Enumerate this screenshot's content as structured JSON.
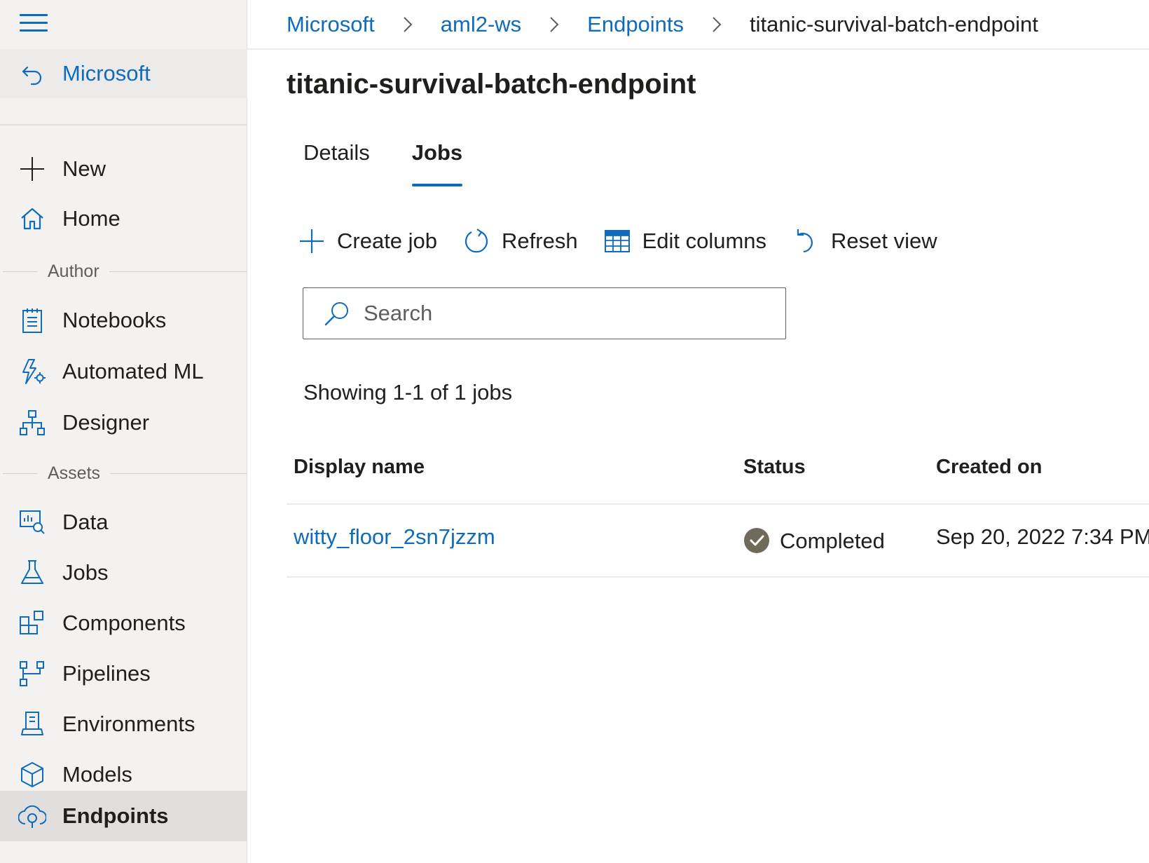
{
  "sidebar": {
    "back_label": "Microsoft",
    "items_top": [
      {
        "label": "New",
        "icon": "plus-icon"
      },
      {
        "label": "Home",
        "icon": "home-icon"
      }
    ],
    "section_author": "Author",
    "items_author": [
      {
        "label": "Notebooks",
        "icon": "notebook-icon"
      },
      {
        "label": "Automated ML",
        "icon": "automated-ml-icon"
      },
      {
        "label": "Designer",
        "icon": "designer-icon"
      }
    ],
    "section_assets": "Assets",
    "items_assets": [
      {
        "label": "Data",
        "icon": "data-icon"
      },
      {
        "label": "Jobs",
        "icon": "flask-icon"
      },
      {
        "label": "Components",
        "icon": "components-icon"
      },
      {
        "label": "Pipelines",
        "icon": "pipelines-icon"
      },
      {
        "label": "Environments",
        "icon": "environments-icon"
      },
      {
        "label": "Models",
        "icon": "cube-icon"
      },
      {
        "label": "Endpoints",
        "icon": "endpoints-icon",
        "active": true
      }
    ]
  },
  "breadcrumb": [
    "Microsoft",
    "aml2-ws",
    "Endpoints",
    "titanic-survival-batch-endpoint"
  ],
  "page_title": "titanic-survival-batch-endpoint",
  "tabs": [
    {
      "label": "Details",
      "active": false
    },
    {
      "label": "Jobs",
      "active": true
    }
  ],
  "toolbar": {
    "create_job": "Create job",
    "refresh": "Refresh",
    "edit_columns": "Edit columns",
    "reset_view": "Reset view"
  },
  "search": {
    "placeholder": "Search",
    "value": ""
  },
  "showing_text": "Showing 1-1 of 1 jobs",
  "table": {
    "columns": [
      "Display name",
      "Status",
      "Created on"
    ],
    "rows": [
      {
        "display_name": "witty_floor_2sn7jzzm",
        "status": "Completed",
        "created_on": "Sep 20, 2022 7:34 PM"
      }
    ]
  },
  "colors": {
    "accent": "#0f6cbd",
    "status_completed": "#6f6a5a",
    "sidebar_bg": "#f3f2f1"
  }
}
